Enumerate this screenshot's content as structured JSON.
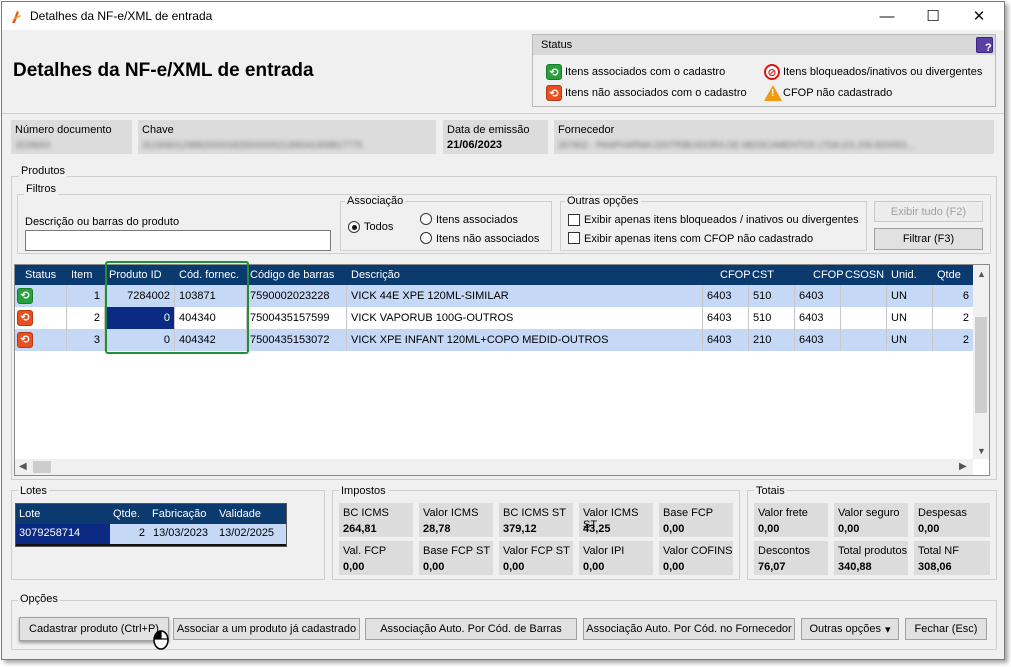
{
  "window": {
    "title": "Detalhes da NF-e/XML de entrada",
    "heading": "Detalhes da NF-e/XML de entrada",
    "controls": {
      "minimize": "—",
      "maximize": "☐",
      "close": "✕"
    }
  },
  "status_legend": {
    "title": "Status",
    "help": "?",
    "items": [
      {
        "label": "Itens associados com o cadastro",
        "icon": "sync-green-icon"
      },
      {
        "label": "Itens bloqueados/inativos ou divergentes",
        "icon": "blocked-red-icon"
      },
      {
        "label": "Itens não associados com o cadastro",
        "icon": "sync-orange-icon"
      },
      {
        "label": "CFOP não cadastrado",
        "icon": "warning-icon"
      }
    ]
  },
  "document": {
    "numero_label": "Número documento",
    "numero_value": "3239693",
    "chave_label": "Chave",
    "chave_value": "31230601298820000182550000021395041908817775",
    "data_label": "Data de emissão",
    "data_value": "21/06/2023",
    "fornecedor_label": "Fornecedor",
    "fornecedor_value": "267802 - PANPHARMA DISTRIBUIDORA DE MEDICAMENTOS LTDA (01.206.820/001..."
  },
  "produtos": {
    "section_label": "Produtos",
    "filtros_label": "Filtros",
    "descricao_label": "Descrição ou barras do produto",
    "descricao_value": "",
    "associacao": {
      "label": "Associação",
      "options": [
        "Todos",
        "Itens associados",
        "Itens não associados"
      ],
      "selected": "Todos"
    },
    "outras_opcoes": {
      "label": "Outras opções",
      "items": [
        "Exibir apenas itens bloqueados / inativos ou divergentes",
        "Exibir apenas itens com CFOP não cadastrado"
      ]
    },
    "exibir_tudo": "Exibir tudo (F2)",
    "filtrar": "Filtrar (F3)"
  },
  "grid": {
    "columns": [
      "Status",
      "Item",
      "Produto ID",
      "Cód. fornec.",
      "Código de barras",
      "Descrição",
      "CFOP",
      "CST",
      "CFOP",
      "CSOSN",
      "Unid.",
      "Qtde"
    ],
    "rows": [
      {
        "status": "associated",
        "item": "1",
        "produto_id": "7284002",
        "cod_fornec": "103871",
        "barras": "7590002023228",
        "descricao": "VICK 44E XPE 120ML-SIMILAR",
        "cfop1": "6403",
        "cst": "510",
        "cfop2": "6403",
        "csosn": "",
        "unid": "UN",
        "qtde": "6"
      },
      {
        "status": "not-associated",
        "item": "2",
        "produto_id": "0",
        "cod_fornec": "404340",
        "barras": "7500435157599",
        "descricao": "VICK VAPORUB 100G-OUTROS",
        "cfop1": "6403",
        "cst": "510",
        "cfop2": "6403",
        "csosn": "",
        "unid": "UN",
        "qtde": "2"
      },
      {
        "status": "not-associated",
        "item": "3",
        "produto_id": "0",
        "cod_fornec": "404342",
        "barras": "7500435153072",
        "descricao": "VICK XPE INFANT 120ML+COPO MEDID-OUTROS",
        "cfop1": "6403",
        "cst": "210",
        "cfop2": "6403",
        "csosn": "",
        "unid": "UN",
        "qtde": "2"
      }
    ]
  },
  "lotes": {
    "label": "Lotes",
    "columns": [
      "Lote",
      "Qtde.",
      "Fabricação",
      "Validade"
    ],
    "rows": [
      {
        "lote": "3079258714",
        "qtde": "2",
        "fabricacao": "13/03/2023",
        "validade": "13/02/2025"
      }
    ]
  },
  "impostos": {
    "label": "Impostos",
    "items": [
      {
        "label": "BC ICMS",
        "value": "264,81"
      },
      {
        "label": "Valor ICMS",
        "value": "28,78"
      },
      {
        "label": "BC ICMS ST",
        "value": "379,12"
      },
      {
        "label": "Valor ICMS ST",
        "value": "43,25"
      },
      {
        "label": "Base FCP",
        "value": "0,00"
      },
      {
        "label": "Val. FCP",
        "value": "0,00"
      },
      {
        "label": "Base FCP ST",
        "value": "0,00"
      },
      {
        "label": "Valor FCP ST",
        "value": "0,00"
      },
      {
        "label": "Valor IPI",
        "value": "0,00"
      },
      {
        "label": "Valor COFINS",
        "value": "0,00"
      }
    ]
  },
  "totais": {
    "label": "Totais",
    "items": [
      {
        "label": "Valor frete",
        "value": "0,00"
      },
      {
        "label": "Valor seguro",
        "value": "0,00"
      },
      {
        "label": "Despesas",
        "value": "0,00"
      },
      {
        "label": "Descontos",
        "value": "76,07"
      },
      {
        "label": "Total produtos",
        "value": "340,88"
      },
      {
        "label": "Total NF",
        "value": "308,06"
      }
    ]
  },
  "opcoes": {
    "label": "Opções",
    "buttons": {
      "cadastrar": "Cadastrar produto (Ctrl+P)",
      "associar": "Associar a um produto já cadastrado",
      "auto_barras": "Associação Auto. Por Cód. de Barras",
      "auto_fornec": "Associação Auto. Por Cód. no Fornecedor",
      "outras": "Outras opções",
      "outras_caret": "▾",
      "fechar": "Fechar (Esc)"
    }
  }
}
